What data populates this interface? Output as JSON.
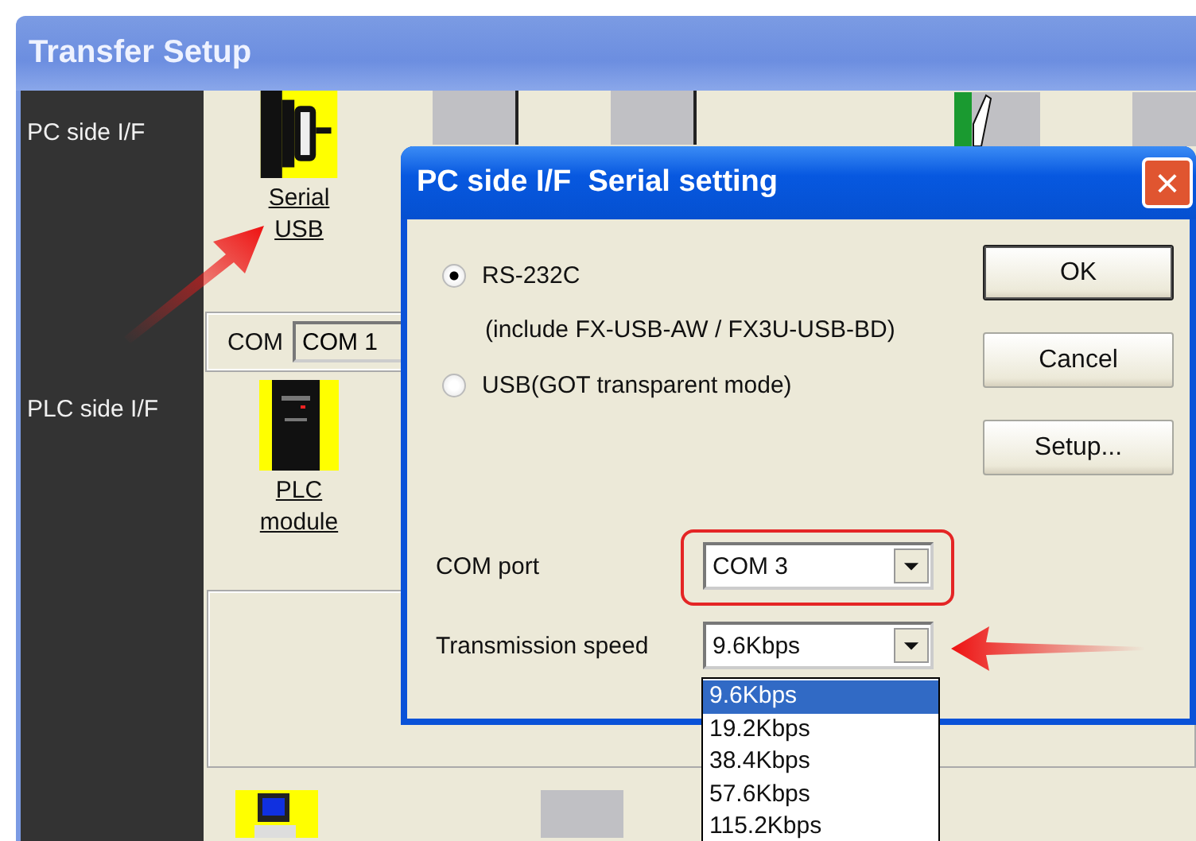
{
  "window": {
    "title": "Transfer Setup"
  },
  "sidebar": {
    "items": [
      {
        "label": "PC side I/F"
      },
      {
        "label": "PLC side I/F"
      }
    ]
  },
  "pc_interface": {
    "label_lines": [
      "Serial",
      "USB"
    ],
    "com_label": "COM",
    "com_value": "COM 1"
  },
  "plc_interface": {
    "label_lines": [
      "PLC",
      "module"
    ]
  },
  "dialog": {
    "title": "PC side I/F  Serial setting",
    "close": "×",
    "options": [
      {
        "label": "RS-232C",
        "note": "(include FX-USB-AW / FX3U-USB-BD)",
        "selected": true
      },
      {
        "label": "USB(GOT transparent mode)",
        "selected": false
      }
    ],
    "buttons": [
      "OK",
      "Cancel",
      "Setup..."
    ],
    "com_port": {
      "label": "COM port",
      "value": "COM 3"
    },
    "speed": {
      "label": "Transmission speed",
      "value": "9.6Kbps",
      "options": [
        {
          "label": "9.6Kbps",
          "selected": true
        },
        {
          "label": "19.2Kbps",
          "selected": false
        },
        {
          "label": "38.4Kbps",
          "selected": false
        },
        {
          "label": "57.6Kbps",
          "selected": false
        },
        {
          "label": "115.2Kbps",
          "selected": false
        }
      ]
    }
  }
}
